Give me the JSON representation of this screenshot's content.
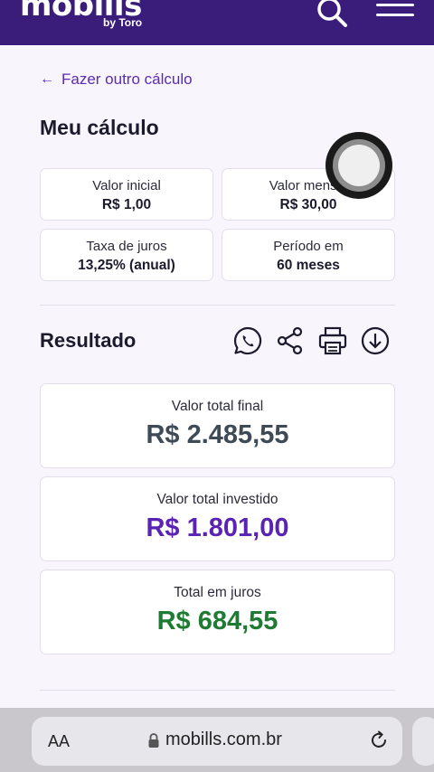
{
  "header": {
    "logo": "mobills",
    "logo_sub": "by Toro"
  },
  "back_link": "Fazer outro cálculo",
  "section_title": "Meu cálculo",
  "inputs": [
    {
      "label": "Valor inicial",
      "value": "R$ 1,00"
    },
    {
      "label": "Valor mensal",
      "value": "R$ 30,00"
    },
    {
      "label": "Taxa de juros",
      "value": "13,25% (anual)"
    },
    {
      "label": "Período em",
      "value": "60 meses"
    }
  ],
  "result": {
    "title": "Resultado",
    "actions": [
      "whatsapp-icon",
      "share-icon",
      "print-icon",
      "download-icon"
    ],
    "cards": [
      {
        "label": "Valor total final",
        "value": "R$ 2.485,55",
        "color": "#3f4a57"
      },
      {
        "label": "Valor total investido",
        "value": "R$ 1.801,00",
        "color": "#5a23b4"
      },
      {
        "label": "Total em juros",
        "value": "R$ 684,55",
        "color": "#1f7a34"
      }
    ]
  },
  "browser": {
    "aa": "AA",
    "url": "mobills.com.br"
  },
  "colors": {
    "brand": "#3a1c7a",
    "accent": "#5b2ab5"
  }
}
